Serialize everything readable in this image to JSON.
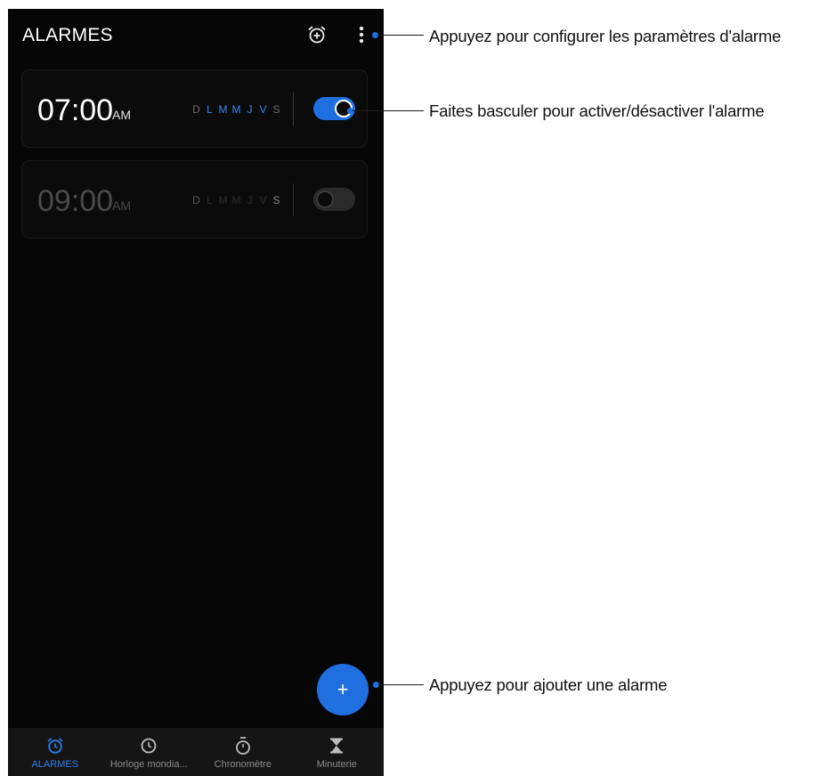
{
  "header": {
    "title": "ALARMES",
    "add_timer_icon": "alarm-add-icon",
    "menu_icon": "more-vertical-icon"
  },
  "alarms": [
    {
      "time": "07:00",
      "period": "AM",
      "days": [
        {
          "label": "D",
          "active": false
        },
        {
          "label": "L",
          "active": true
        },
        {
          "label": "M",
          "active": true
        },
        {
          "label": "M",
          "active": true
        },
        {
          "label": "J",
          "active": true
        },
        {
          "label": "V",
          "active": true
        },
        {
          "label": "S",
          "active": false
        }
      ],
      "enabled": true
    },
    {
      "time": "09:00",
      "period": "AM",
      "days": [
        {
          "label": "D",
          "active": true
        },
        {
          "label": "L",
          "active": false
        },
        {
          "label": "M",
          "active": false
        },
        {
          "label": "M",
          "active": false
        },
        {
          "label": "J",
          "active": false
        },
        {
          "label": "V",
          "active": false
        },
        {
          "label": "S",
          "active": true
        }
      ],
      "enabled": false
    }
  ],
  "fab": {
    "label": "+",
    "icon": "add-icon"
  },
  "bottom_nav": [
    {
      "label": "ALARMES",
      "icon": "alarm-clock-icon",
      "active": true
    },
    {
      "label": "Horloge mondia...",
      "icon": "clock-icon",
      "active": false
    },
    {
      "label": "Chronomètre",
      "icon": "stopwatch-icon",
      "active": false
    },
    {
      "label": "Minuterie",
      "icon": "hourglass-icon",
      "active": false
    }
  ],
  "callouts": {
    "settings": "Appuyez pour configurer les paramètres d'alarme",
    "toggle": "Faites basculer pour activer/désactiver l'alarme",
    "add": "Appuyez pour ajouter une alarme"
  },
  "colors": {
    "accent": "#1f6fe0",
    "background": "#060606",
    "card": "#0b0b0b",
    "nav": "#151515",
    "active_day": "#3d86e6",
    "inactive_day_on": "#6a6a6a",
    "disabled_text": "#4a4a4a"
  }
}
